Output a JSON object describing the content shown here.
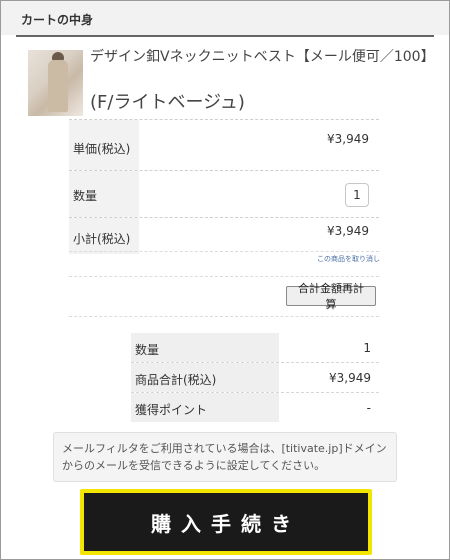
{
  "header": {
    "title": "カートの中身"
  },
  "product": {
    "name": "デザイン釦Vネックニットベスト【メール便可／100】",
    "variant": "(F/ライトベージュ)"
  },
  "details": {
    "unit_price_label": "単価(税込)",
    "unit_price_value": "¥3,949",
    "quantity_label": "数量",
    "quantity_value": "1",
    "subtotal_label": "小計(税込)",
    "subtotal_value": "¥3,949",
    "remove_link": "この商品を取り消し"
  },
  "recalc_button": "合計金額再計算",
  "summary": {
    "quantity_label": "数量",
    "quantity_value": "1",
    "total_label": "商品合計(税込)",
    "total_value": "¥3,949",
    "points_label": "獲得ポイント",
    "points_value": "-"
  },
  "notice": "メールフィルタをご利用されている場合は、[titivate.jp]ドメインからのメールを受信できるように設定してください。",
  "checkout_button": "購入手続き",
  "colors": {
    "checkout_border": "#f2e600",
    "checkout_bg": "#1a1a1a"
  }
}
